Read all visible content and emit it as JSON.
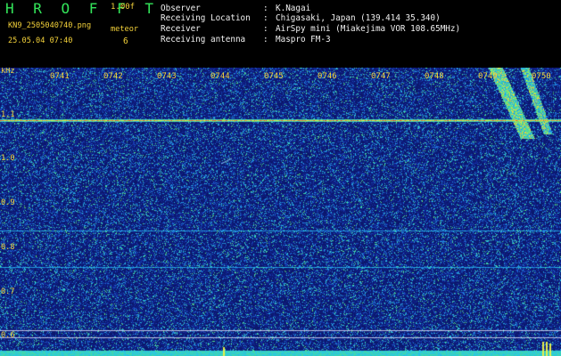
{
  "header": {
    "title": "H R O F F T",
    "version": "1.00f",
    "filename": "KN9_2505040740.png",
    "datetime": "25.05.04 07:40",
    "meteor_label": "meteor",
    "meteor_count": "6"
  },
  "info": [
    {
      "key": "Observer",
      "value": "K.Nagai"
    },
    {
      "key": "Receiving Location",
      "value": "Chigasaki, Japan (139.414 35.340)"
    },
    {
      "key": "Receiver",
      "value": "AirSpy mini (Miakejima VOR 108.65MHz)"
    },
    {
      "key": "Receiving antenna",
      "value": "Maspro FM-3"
    }
  ],
  "plot": {
    "unit_label": "kHz",
    "y_ticks": [
      "1.1",
      "1.0",
      "0.9",
      "0.8",
      "0.7",
      "0.6"
    ],
    "time_ticks": [
      "0741",
      "0742",
      "0743",
      "0744",
      "0745",
      "0746",
      "0747",
      "0748",
      "0749",
      "0750"
    ],
    "colors": {
      "background": "#0d1c6e",
      "carrier": "#e8f04a",
      "noise_floor": "#2fd4ff",
      "label": "#f4d23a"
    }
  }
}
